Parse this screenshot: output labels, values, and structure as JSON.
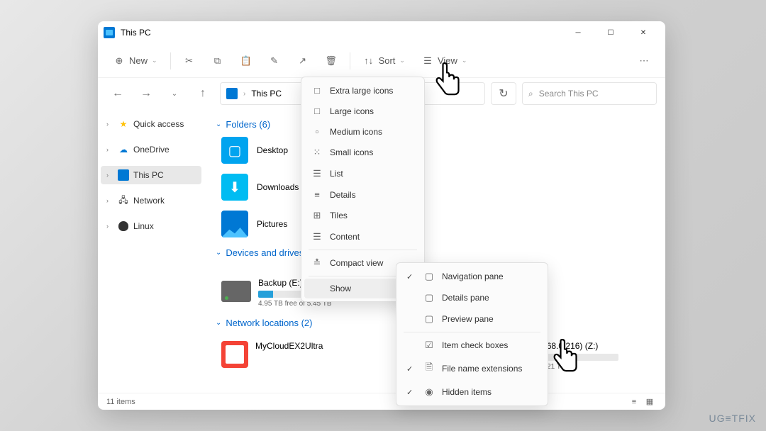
{
  "window": {
    "title": "This PC"
  },
  "toolbar": {
    "new": "New",
    "sort": "Sort",
    "view": "View"
  },
  "address": {
    "path": "This PC"
  },
  "search": {
    "placeholder": "Search This PC"
  },
  "sidebar": {
    "items": [
      {
        "label": "Quick access"
      },
      {
        "label": "OneDrive"
      },
      {
        "label": "This PC"
      },
      {
        "label": "Network"
      },
      {
        "label": "Linux"
      }
    ]
  },
  "sections": {
    "folders": {
      "title": "Folders (6)",
      "items": [
        {
          "label": "Desktop"
        },
        {
          "label": "Downloads"
        },
        {
          "label": "Pictures"
        }
      ]
    },
    "drives": {
      "title": "Devices and drives (3)",
      "items": [
        {
          "label": "Backup (E:)",
          "free": "4.95 TB free of 5.45 TB",
          "fill": 12
        },
        {
          "label": "Public (\\\\192.168.0.216) (Z:)",
          "free": "7.12 TB free of 7.21 TB",
          "fill": 4
        }
      ]
    },
    "network": {
      "title": "Network locations (2)",
      "items": [
        {
          "label": "MyCloudEX2Ultra"
        }
      ]
    }
  },
  "status": {
    "count": "11 items"
  },
  "viewMenu": {
    "items": [
      {
        "label": "Extra large icons"
      },
      {
        "label": "Large icons"
      },
      {
        "label": "Medium icons"
      },
      {
        "label": "Small icons"
      },
      {
        "label": "List"
      },
      {
        "label": "Details"
      },
      {
        "label": "Tiles"
      },
      {
        "label": "Content"
      },
      {
        "label": "Compact view"
      },
      {
        "label": "Show"
      }
    ]
  },
  "showMenu": {
    "items": [
      {
        "label": "Navigation pane",
        "checked": true
      },
      {
        "label": "Details pane",
        "checked": false
      },
      {
        "label": "Preview pane",
        "checked": false
      },
      {
        "label": "Item check boxes",
        "checked": false
      },
      {
        "label": "File name extensions",
        "checked": true
      },
      {
        "label": "Hidden items",
        "checked": true
      }
    ]
  },
  "watermark": "UG≡TFIX"
}
